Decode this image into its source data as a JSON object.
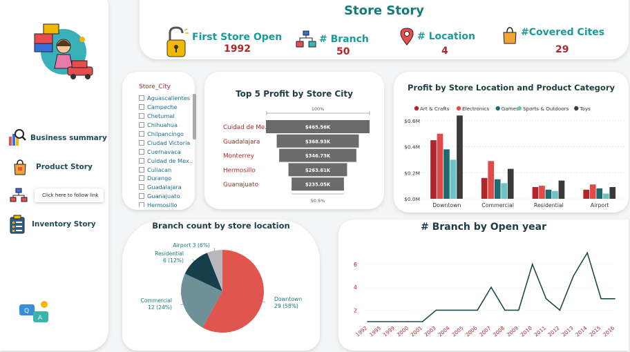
{
  "sidebar": {
    "nav": [
      {
        "label": "Business summary",
        "icon": "bar-chart-magnifier-icon"
      },
      {
        "label": "Product Story",
        "icon": "shopping-bag-icon"
      },
      {
        "label": "",
        "icon": "network-branch-icon"
      },
      {
        "label": "Inventory Story",
        "icon": "clipboard-inventory-icon"
      }
    ],
    "tooltip": "Click here to follow link"
  },
  "header": {
    "title": "Store Story",
    "kpis": [
      {
        "label": "First Store Open",
        "value": "1992",
        "icon": "unlocked-padlock-icon"
      },
      {
        "label": "# Branch",
        "value": "50",
        "icon": "store-network-icon"
      },
      {
        "label": "# Location",
        "value": "4",
        "icon": "map-pin-icon"
      },
      {
        "label": "#Covered Cites",
        "value": "29",
        "icon": "shopping-bag-icon"
      }
    ]
  },
  "slicer": {
    "title": "Store_City",
    "items": [
      "Aguascalientes",
      "Campeche",
      "Chetumal",
      "Chihuahua",
      "Chilpancingo",
      "Ciudad Victoria",
      "Cuernavaca",
      "Cuidad de Mex...",
      "Culiacan",
      "Durango",
      "Guadalajara",
      "Guanajuato",
      "Hermosillo"
    ]
  },
  "chart_data": [
    {
      "type": "bar",
      "title": "Top 5 Profit by Store City",
      "categories": [
        "Cuidad de Me...",
        "Guadalajara",
        "Monterrey",
        "Hermosillo",
        "Guanajuato"
      ],
      "values": [
        465560,
        368930,
        346730,
        263610,
        235050
      ],
      "value_labels": [
        "$465.56K",
        "$368.93K",
        "$346.73K",
        "$263.61K",
        "$235.05K"
      ],
      "top_label": "100%",
      "bottom_label": "50.5%",
      "orientation": "funnel"
    },
    {
      "type": "bar",
      "title": "Profit by Store Location and Product Category",
      "categories": [
        "Downtown",
        "Commercial",
        "Residential",
        "Airport"
      ],
      "series": [
        {
          "name": "Art & Crafts",
          "values": [
            0.45,
            0.16,
            0.09,
            0.07
          ],
          "color": "#b0262a"
        },
        {
          "name": "Electronics",
          "values": [
            0.5,
            0.29,
            0.1,
            0.11
          ],
          "color": "#e04a48"
        },
        {
          "name": "Games",
          "values": [
            0.38,
            0.15,
            0.07,
            0.08
          ],
          "color": "#1d6b70"
        },
        {
          "name": "Sports & Outdoors",
          "values": [
            0.3,
            0.12,
            0.06,
            0.04
          ],
          "color": "#6fc2c4"
        },
        {
          "name": "Toys",
          "values": [
            0.64,
            0.23,
            0.14,
            0.09
          ],
          "color": "#3a3a3a"
        }
      ],
      "yticks": [
        "$0.0M",
        "$0.2M",
        "$0.4M",
        "$0.6M"
      ],
      "ylim": [
        0,
        0.7
      ],
      "legend": "top"
    },
    {
      "type": "pie",
      "title": "Branch count by store location",
      "slices": [
        {
          "name": "Downtown",
          "value": 29,
          "pct": "58%",
          "color": "#e0554d"
        },
        {
          "name": "Commercial",
          "value": 12,
          "pct": "24%",
          "color": "#6d9197"
        },
        {
          "name": "Residential",
          "value": 6,
          "pct": "12%",
          "color": "#173f4b"
        },
        {
          "name": "Airport",
          "value": 3,
          "pct": "6%",
          "color": "#b9b9b9"
        }
      ]
    },
    {
      "type": "line",
      "title": "# Branch by Open year",
      "x": [
        "1992",
        "1995",
        "1999",
        "2000",
        "2001",
        "2003",
        "2004",
        "2005",
        "2006",
        "2007",
        "2008",
        "2009",
        "2010",
        "2011",
        "2012",
        "2013",
        "2014",
        "2015",
        "2016"
      ],
      "y": [
        1,
        1,
        1,
        1,
        1,
        2,
        2,
        2,
        2,
        4,
        2,
        2,
        6,
        3,
        2,
        5,
        7,
        3,
        3
      ],
      "yticks": [
        2,
        4,
        6
      ],
      "ylim": [
        1,
        7.5
      ],
      "color": "#1f4a4a"
    }
  ]
}
